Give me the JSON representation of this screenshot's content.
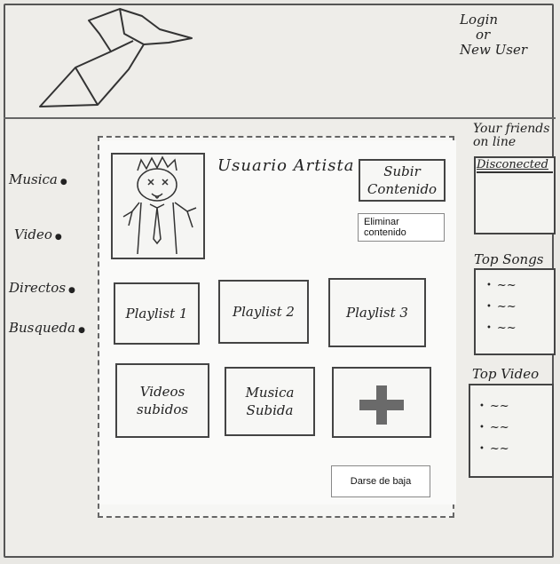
{
  "header": {
    "login_label": "Login",
    "or_label": "or",
    "new_user_label": "New User"
  },
  "nav": {
    "items": [
      {
        "label": "Musica"
      },
      {
        "label": "Video"
      },
      {
        "label": "Directos"
      },
      {
        "label": "Busqueda"
      }
    ],
    "arrow": "●"
  },
  "profile": {
    "title": "Usuario Artista",
    "upload_button": "Subir Contenido",
    "delete_button": "Eliminar contenido",
    "unsubscribe_button": "Darse de baja"
  },
  "grid": {
    "tiles": [
      {
        "label": "Playlist 1"
      },
      {
        "label": "Playlist 2"
      },
      {
        "label": "Playlist 3"
      },
      {
        "label": "Videos subidos"
      },
      {
        "label": "Musica Subida"
      }
    ]
  },
  "sidebar": {
    "friends_title": "Your friends on line",
    "friends_status": "Disconected",
    "top_songs_title": "Top Songs",
    "top_video_title": "Top Video",
    "bullet": "•",
    "wave": "~~"
  }
}
